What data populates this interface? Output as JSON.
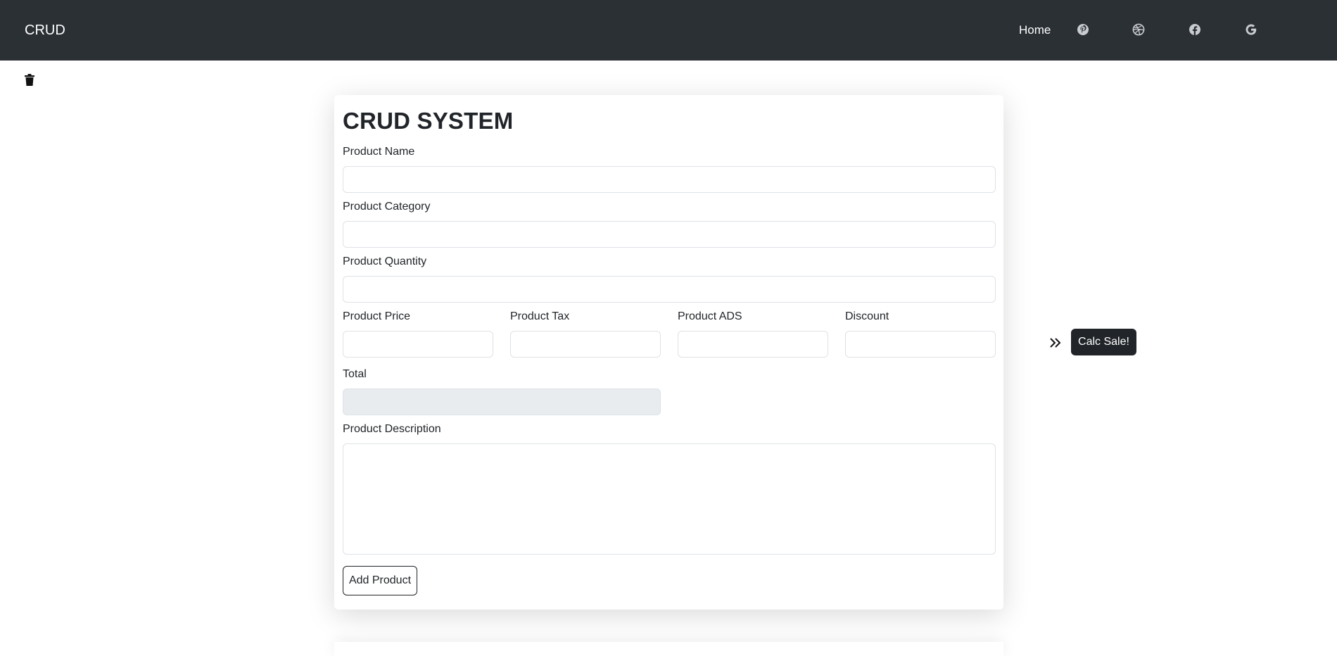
{
  "navbar": {
    "brand": "CRUD",
    "home_label": "Home",
    "icons": [
      "pinterest-icon",
      "dribbble-icon",
      "facebook-icon",
      "google-icon"
    ],
    "background": "#2b3035"
  },
  "form": {
    "title": "CRUD SYSTEM",
    "product_name": {
      "label": "Product Name",
      "value": ""
    },
    "product_category": {
      "label": "Product Category",
      "value": ""
    },
    "product_quantity": {
      "label": "Product Quantity",
      "value": ""
    },
    "product_price": {
      "label": "Product Price",
      "value": ""
    },
    "product_tax": {
      "label": "Product Tax",
      "value": ""
    },
    "product_ads": {
      "label": "Product ADS",
      "value": ""
    },
    "discount": {
      "label": "Discount",
      "value": ""
    },
    "total": {
      "label": "Total",
      "value": ""
    },
    "product_description": {
      "label": "Product Description",
      "value": ""
    },
    "add_button": "Add Product"
  },
  "side": {
    "calc_button": "Calc Sale!"
  },
  "colors": {
    "dark": "#212529",
    "border": "#dee2e6",
    "disabled": "#e9ecef"
  }
}
